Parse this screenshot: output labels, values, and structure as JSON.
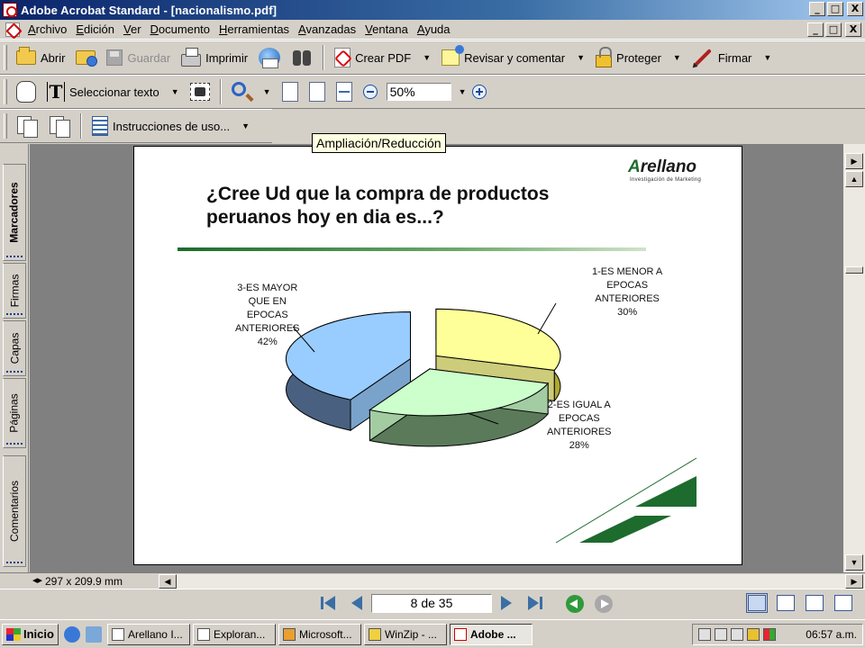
{
  "window": {
    "title": "Adobe Acrobat Standard - [nacionalismo.pdf]"
  },
  "window_buttons": {
    "minimize": "_",
    "maximize": "□",
    "close": "X"
  },
  "menu": [
    "Archivo",
    "Edición",
    "Ver",
    "Documento",
    "Herramientas",
    "Avanzadas",
    "Ventana",
    "Ayuda"
  ],
  "toolbar1": {
    "open": "Abrir",
    "save": "Guardar",
    "print": "Imprimir",
    "create_pdf": "Crear PDF",
    "review": "Revisar y comentar",
    "protect": "Proteger",
    "sign": "Firmar"
  },
  "toolbar2": {
    "select_text": "Seleccionar texto",
    "zoom_value": "50%"
  },
  "toolbar3": {
    "instructions": "Instrucciones de uso..."
  },
  "tooltip": "Ampliación/Reducción",
  "side_tabs": [
    "Marcadores",
    "Firmas",
    "Capas",
    "Páginas",
    "Comentarios"
  ],
  "slide": {
    "title_line1": "¿Cree Ud que la compra de productos",
    "title_line2": "peruanos hoy en dia es...?",
    "logo_text": "rellano",
    "logo_mark": "A",
    "logo_sub": "Investigación de Marketing"
  },
  "chart_data": {
    "type": "pie",
    "slices": [
      {
        "label_lines": [
          "1-ES MENOR A",
          "EPOCAS",
          "ANTERIORES",
          "30%"
        ],
        "value": 30,
        "color": "#ffff99"
      },
      {
        "label_lines": [
          "2-ES IGUAL A",
          "EPOCAS",
          "ANTERIORES",
          "28%"
        ],
        "value": 28,
        "color": "#ccffcc"
      },
      {
        "label_lines": [
          "3-ES MAYOR",
          "QUE EN",
          "EPOCAS",
          "ANTERIORES",
          "42%"
        ],
        "value": 42,
        "color": "#99ccff"
      }
    ],
    "exploded": true,
    "three_d": true,
    "legend": "none"
  },
  "status": {
    "page_size": "297 x 209.9 mm",
    "page_indicator": "8 de 35"
  },
  "taskbar": {
    "start": "Inicio",
    "tasks": [
      "Arellano I...",
      "Exploran...",
      "Microsoft...",
      "WinZip - ...",
      "Adobe ..."
    ],
    "clock": "06:57 a.m."
  }
}
